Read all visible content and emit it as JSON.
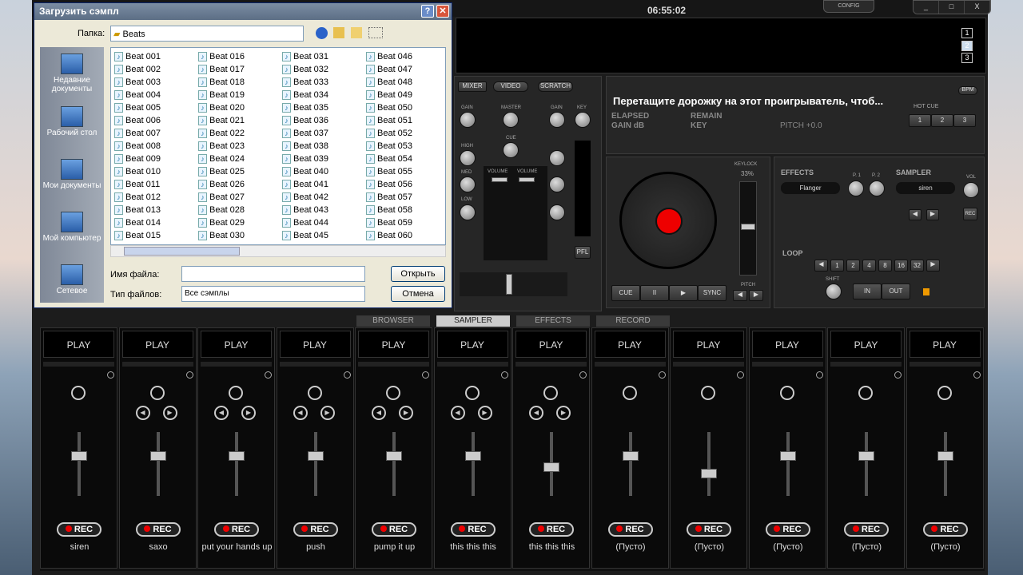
{
  "top": {
    "clock": "06:55:02",
    "config": "CONFIG",
    "min": "_",
    "max": "□",
    "close": "X",
    "video_slots": [
      "1",
      "2",
      "3"
    ]
  },
  "mixer": {
    "tabs": [
      "MIXER",
      "VIDEO",
      "SCRATCH"
    ],
    "gain": "GAIN",
    "master": "MASTER",
    "key": "KEY",
    "high": "HIGH",
    "cue": "CUE",
    "med": "MED",
    "low": "LOW",
    "volume": "VOLUME",
    "pfl": "PFL"
  },
  "deck": {
    "track": "Перетащите дорожку на этот проигрыватель, чтоб...",
    "elapsed": "ELAPSED",
    "remain": "REMAIN",
    "gain": "GAIN dB",
    "key": "KEY",
    "pitch": "PITCH +0.0",
    "bpm": "BPM",
    "hot_cue": "HOT CUE",
    "hot_cues": [
      "1",
      "2",
      "3"
    ],
    "keylock": "KEYLOCK",
    "keylock_pct": "33%",
    "pitch_label": "PITCH",
    "transport": [
      "CUE",
      "II",
      "▶",
      "SYNC"
    ]
  },
  "effects": {
    "title": "EFFECTS",
    "selected": "Flanger",
    "p1": "P. 1",
    "p2": "P. 2"
  },
  "sampler_panel": {
    "title": "SAMPLER",
    "selected": "siren",
    "vol": "VOL",
    "rec": "REC"
  },
  "loop": {
    "title": "LOOP",
    "sizes": [
      "1",
      "2",
      "4",
      "8",
      "16",
      "32"
    ],
    "shift": "SHIFT",
    "in": "IN",
    "out": "OUT"
  },
  "bottom_tabs": [
    {
      "label": "BROWSER",
      "active": false
    },
    {
      "label": "SAMPLER",
      "active": true
    },
    {
      "label": "EFFECTS",
      "active": false
    },
    {
      "label": "RECORD",
      "active": false
    }
  ],
  "sampler": [
    {
      "play": "PLAY",
      "rec": "REC",
      "name": "siren"
    },
    {
      "play": "PLAY",
      "rec": "REC",
      "name": "saxo"
    },
    {
      "play": "PLAY",
      "rec": "REC",
      "name": "put your hands up"
    },
    {
      "play": "PLAY",
      "rec": "REC",
      "name": "push"
    },
    {
      "play": "PLAY",
      "rec": "REC",
      "name": "pump it up"
    },
    {
      "play": "PLAY",
      "rec": "REC",
      "name": "this this this"
    },
    {
      "play": "PLAY",
      "rec": "REC",
      "name": "this this this"
    },
    {
      "play": "PLAY",
      "rec": "REC",
      "name": "(Пусто)"
    },
    {
      "play": "PLAY",
      "rec": "REC",
      "name": "(Пусто)"
    },
    {
      "play": "PLAY",
      "rec": "REC",
      "name": "(Пусто)"
    },
    {
      "play": "PLAY",
      "rec": "REC",
      "name": "(Пусто)"
    },
    {
      "play": "PLAY",
      "rec": "REC",
      "name": "(Пусто)"
    }
  ],
  "dialog": {
    "title": "Загрузить сэмпл",
    "folder_label": "Папка:",
    "folder": "Beats",
    "places": [
      "Недавние документы",
      "Рабочий стол",
      "Мои документы",
      "Мой компьютер",
      "Сетевое"
    ],
    "files": [
      "Beat 001",
      "Beat 002",
      "Beat 003",
      "Beat 004",
      "Beat 005",
      "Beat 006",
      "Beat 007",
      "Beat 008",
      "Beat 009",
      "Beat 010",
      "Beat 011",
      "Beat 012",
      "Beat 013",
      "Beat 014",
      "Beat 015",
      "Beat 016",
      "Beat 017",
      "Beat 018",
      "Beat 019",
      "Beat 020",
      "Beat 021",
      "Beat 022",
      "Beat 023",
      "Beat 024",
      "Beat 025",
      "Beat 026",
      "Beat 027",
      "Beat 028",
      "Beat 029",
      "Beat 030",
      "Beat 031",
      "Beat 032",
      "Beat 033",
      "Beat 034",
      "Beat 035",
      "Beat 036",
      "Beat 037",
      "Beat 038",
      "Beat 039",
      "Beat 040",
      "Beat 041",
      "Beat 042",
      "Beat 043",
      "Beat 044",
      "Beat 045",
      "Beat 046",
      "Beat 047",
      "Beat 048",
      "Beat 049",
      "Beat 050",
      "Beat 051",
      "Beat 052",
      "Beat 053",
      "Beat 054",
      "Beat 055",
      "Beat 056",
      "Beat 057",
      "Beat 058",
      "Beat 059",
      "Beat 060"
    ],
    "filename_label": "Имя файла:",
    "filename": "",
    "filetype_label": "Тип файлов:",
    "filetype": "Все сэмплы",
    "open": "Открыть",
    "cancel": "Отмена"
  }
}
